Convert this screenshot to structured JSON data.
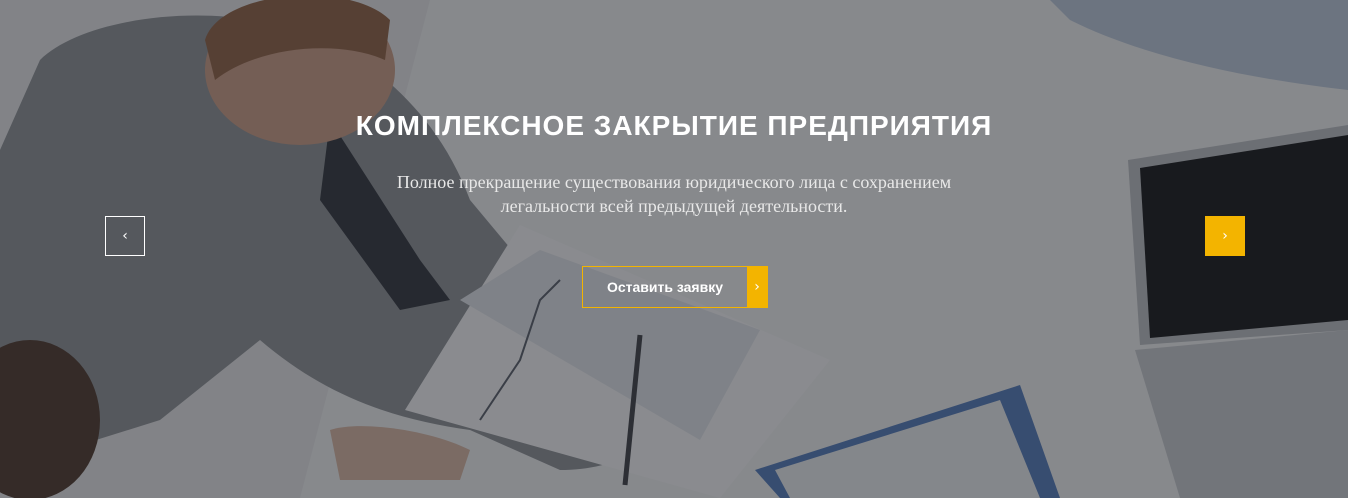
{
  "slide": {
    "title": "КОМПЛЕКСНОЕ ЗАКРЫТИЕ ПРЕДПРИЯТИЯ",
    "subtitle": "Полное прекращение существования юридического лица с сохранением легальности всей предыдущей деятельности.",
    "cta_label": "Оставить заявку",
    "cta_icon": "chevron-right-icon"
  },
  "nav": {
    "prev_icon": "‹",
    "next_icon": "›",
    "cta_arrow": "›"
  },
  "colors": {
    "accent": "#f3b400",
    "overlay": "rgba(32,34,40,0.50)",
    "text": "#ffffff"
  }
}
